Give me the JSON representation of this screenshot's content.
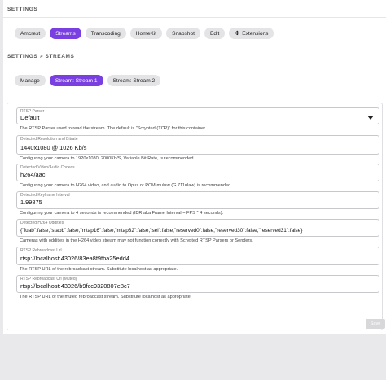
{
  "settings_title": "SETTINGS",
  "settings_tabs": [
    {
      "label": "Amcrest"
    },
    {
      "label": "Streams"
    },
    {
      "label": "Transcoding"
    },
    {
      "label": "HomeKit"
    },
    {
      "label": "Snapshot"
    },
    {
      "label": "Edit"
    },
    {
      "label": "Extensions",
      "icon": "puzzle-icon"
    }
  ],
  "streams_title": "SETTINGS > STREAMS",
  "stream_tabs": [
    {
      "label": "Manage"
    },
    {
      "label": "Stream: Stream 1"
    },
    {
      "label": "Stream: Stream 2"
    }
  ],
  "fields": {
    "rtsp_parser": {
      "label": "RTSP Parser",
      "value": "Default",
      "help": "The RTSP Parser used to read the stream. The default is \"Scrypted (TCP)\" for this container."
    },
    "resolution": {
      "label": "Detected Resolution and Bitrate",
      "value": "1440x1080 @ 1026 Kb/s",
      "help": "Configuring your camera to 1920x1080, 2000Kb/S, Variable Bit Rate, is recommended."
    },
    "codecs": {
      "label": "Detected Video/Audio Codecs",
      "value": "h264/aac",
      "help": "Configuring your camera to H264 video, and audio to Opus or PCM-mulaw (G.711ulaw) is recommended."
    },
    "keyframe": {
      "label": "Detected Keyframe Interval",
      "value": "1.99875",
      "help": "Configuring your camera to 4 seconds is recommended (IDR aka Frame Interval = FPS * 4 seconds)."
    },
    "oddities": {
      "label": "Detected H264 Oddities",
      "value": "{\"fuab\":false,\"stapb\":false,\"mtap16\":false,\"mtap32\":false,\"sei\":false,\"reserved0\":false,\"reserved30\":false,\"reserved31\":false}",
      "help": "Cameras with oddities in the H264 video stream may not function correctly with Scrypted RTSP Parsers or Senders."
    },
    "rebroadcast": {
      "label": "RTSP Rebroadcast Url",
      "value": "rtsp://localhost:43026/83ea8f9fba25edd4",
      "help": "The RTSP URL of the rebroadcast stream. Substitute localhost as appropriate."
    },
    "rebroadcast_muted": {
      "label": "RTSP Rebroadcast Url (Muted)",
      "value": "rtsp://localhost:43026/b9fcc9320807e8c7",
      "help": "The RTSP URL of the muted rebroadcast stream. Substitute localhost as appropriate."
    }
  },
  "save_label": "Save",
  "colors": {
    "accent": "#7a3fe0",
    "chip": "#e4e4e6",
    "background": "#e9e9ec"
  }
}
